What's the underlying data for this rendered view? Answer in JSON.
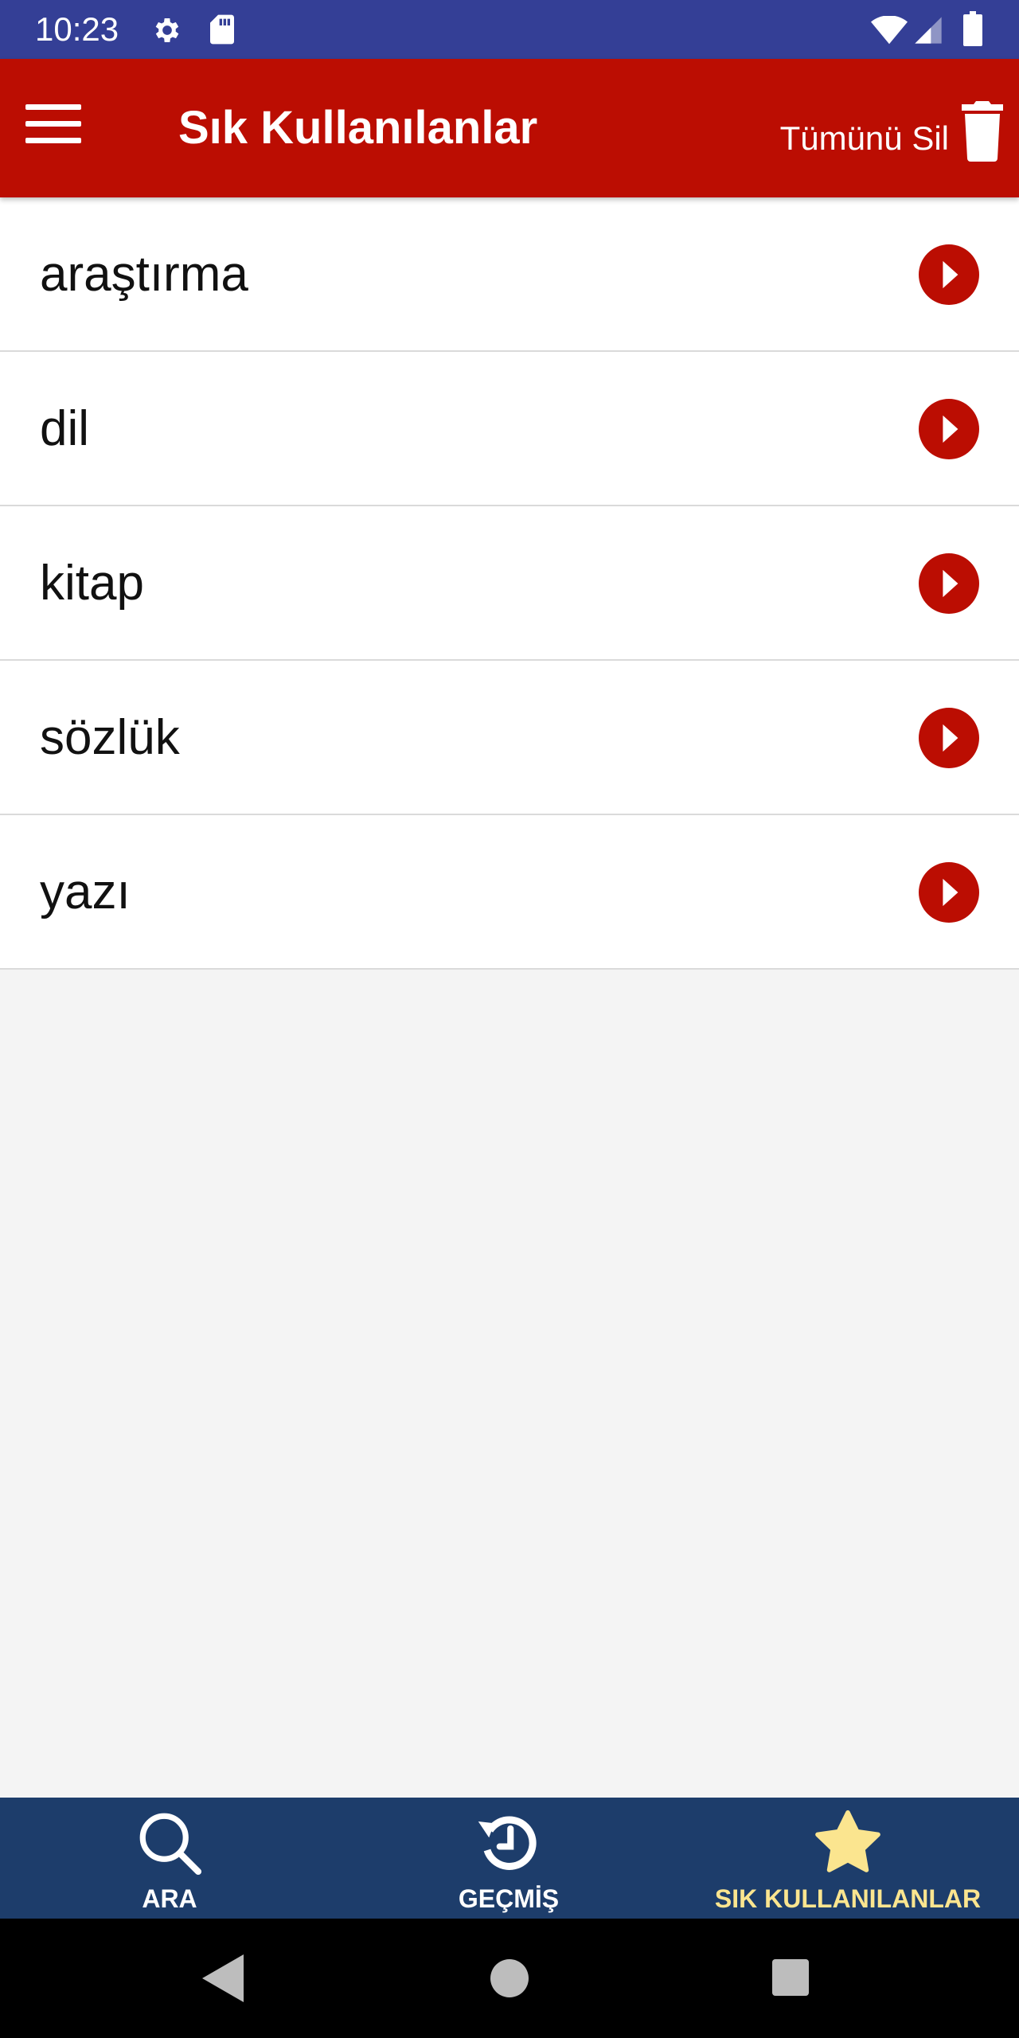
{
  "status_bar": {
    "time": "10:23",
    "icons": [
      "gear-icon",
      "sd-card-icon",
      "wifi-icon",
      "signal-icon",
      "battery-icon"
    ]
  },
  "app_bar": {
    "title": "Sık Kullanılanlar",
    "clear_all_label": "Tümünü Sil",
    "menu_icon": "menu-icon",
    "clear_icon": "trash-icon"
  },
  "favorites": [
    {
      "word": "araştırma"
    },
    {
      "word": "dil"
    },
    {
      "word": "kitap"
    },
    {
      "word": "sözlük"
    },
    {
      "word": "yazı"
    }
  ],
  "bottom_nav": {
    "items": [
      {
        "label": "ARA",
        "icon": "search-icon",
        "active": false
      },
      {
        "label": "GEÇMİŞ",
        "icon": "history-icon",
        "active": false
      },
      {
        "label": "SIK KULLANILANLAR",
        "icon": "star-icon",
        "active": true
      }
    ]
  },
  "colors": {
    "status_bar": "#343f96",
    "app_bar": "#bb0d02",
    "accent": "#bb0d02",
    "bottom_nav": "#1d3d6b",
    "active_tab": "#fbe58f",
    "background": "#f4f4f4"
  }
}
